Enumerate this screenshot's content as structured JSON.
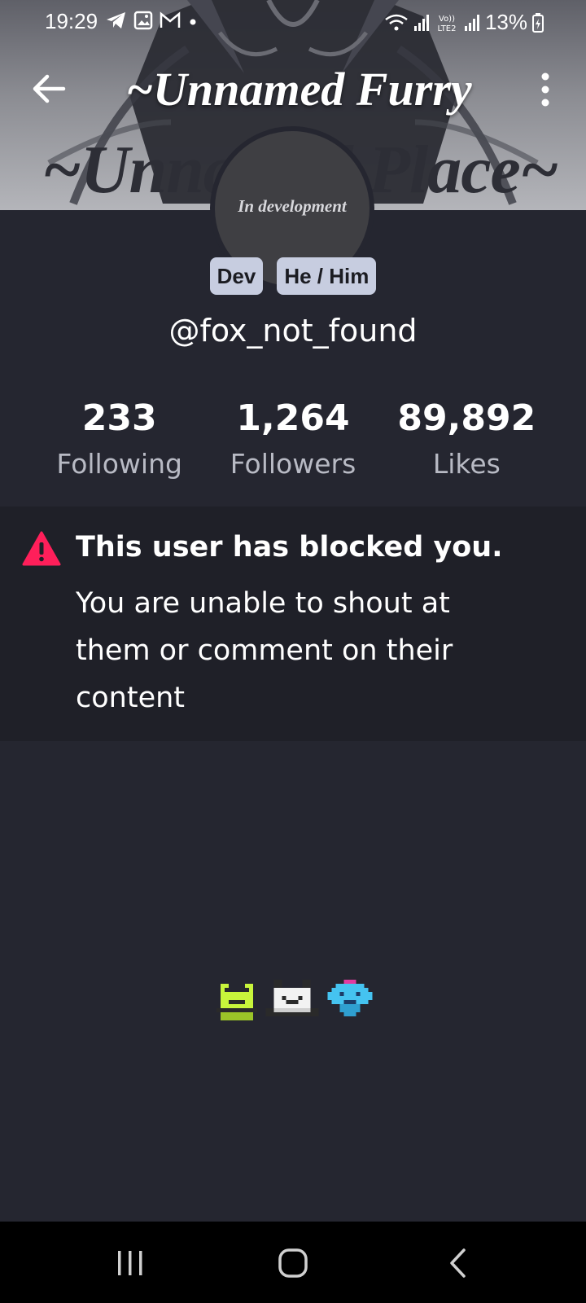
{
  "status_bar": {
    "time": "19:29",
    "battery": "13%",
    "icons_left": [
      "telegram-icon",
      "gallery-icon",
      "gmail-icon",
      "dot-icon"
    ],
    "icons_right": [
      "wifi-icon",
      "signal-icon",
      "volte-icon",
      "signal-icon-2",
      "battery-icon"
    ]
  },
  "header": {
    "title": "~Unnamed Furry",
    "banner_text": "~Unnamed Place~"
  },
  "profile": {
    "avatar_text": "In development",
    "badges": [
      "Dev",
      "He / Him"
    ],
    "handle": "@fox_not_found"
  },
  "stats": [
    {
      "value": "233",
      "label": "Following"
    },
    {
      "value": "1,264",
      "label": "Followers"
    },
    {
      "value": "89,892",
      "label": "Likes"
    }
  ],
  "notice": {
    "title": "This user has blocked you.",
    "body": "You are unable to shout at them or comment on their content",
    "accent": "#ff1f5a"
  },
  "colors": {
    "background": "#252630",
    "notice_bg": "#1f2028",
    "badge_bg": "#c7cde0"
  }
}
